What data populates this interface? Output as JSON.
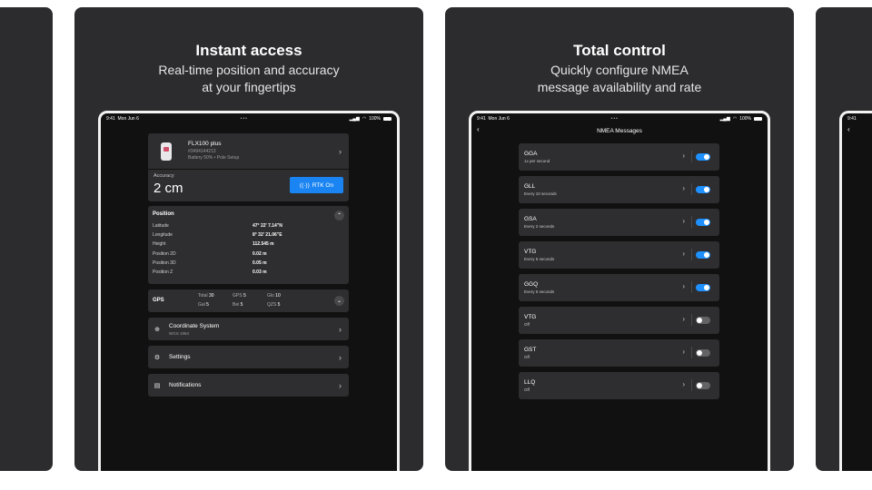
{
  "colors": {
    "accent": "#1a84f2",
    "card_bg": "#2c2c2e",
    "screen_bg": "#111111",
    "toggle_on": "#1e90ff"
  },
  "panel1": {
    "title": "Instant access",
    "subtitle": "Real-time position and accuracy\nat your fingertips",
    "status": {
      "time": "9:41",
      "date": "Mon Jun 6",
      "dots": "•••",
      "battery": "100%"
    },
    "device": {
      "name": "FLX100 plus",
      "serial": "#3494144213",
      "info": "Battery 50% • Pole Setup",
      "icon": "receiver-device"
    },
    "accuracy": {
      "label": "Accuracy",
      "value": "2 cm",
      "rtk_button": "RTK On"
    },
    "position": {
      "title": "Position",
      "rows": [
        {
          "k": "Latitude",
          "v": "47° 22' 7.14\"N"
        },
        {
          "k": "Longitude",
          "v": "8° 32' 21.06\"E"
        },
        {
          "k": "Height",
          "v": "112.545  m"
        },
        {
          "k": "Position 2D",
          "v": "0.02 m"
        },
        {
          "k": "Position 3D",
          "v": "0.05 m"
        },
        {
          "k": "Position Z",
          "v": "0.03 m"
        }
      ]
    },
    "gps": {
      "title": "GPS",
      "cells": [
        {
          "label": "Total",
          "value": "30"
        },
        {
          "label": "GPS",
          "value": "5"
        },
        {
          "label": "Glo",
          "value": "10"
        },
        {
          "label": "Gal",
          "value": "5"
        },
        {
          "label": "Bei",
          "value": "5"
        },
        {
          "label": "QZS",
          "value": "5"
        }
      ]
    },
    "menu": [
      {
        "label": "Coordinate System",
        "sub": "WGS 1984",
        "icon": "globe-icon"
      },
      {
        "label": "Settings",
        "sub": "",
        "icon": "gear-icon"
      },
      {
        "label": "Notifications",
        "sub": "",
        "icon": "clipboard-icon"
      }
    ]
  },
  "panel2": {
    "title": "Total control",
    "subtitle": "Quickly configure NMEA\nmessage availability and rate",
    "status": {
      "time": "9:41",
      "date": "Mon Jun 6",
      "dots": "•••",
      "battery": "100%"
    },
    "nav_title": "NMEA Messages",
    "messages": [
      {
        "name": "GGA",
        "rate": "1x per second",
        "enabled": true
      },
      {
        "name": "GLL",
        "rate": "Every 10 seconds",
        "enabled": true
      },
      {
        "name": "GSA",
        "rate": "Every 2 seconds",
        "enabled": true
      },
      {
        "name": "VTG",
        "rate": "Every 5 seconds",
        "enabled": true
      },
      {
        "name": "GGQ",
        "rate": "Every 5 seconds",
        "enabled": true
      },
      {
        "name": "VTG",
        "rate": "Off",
        "enabled": false
      },
      {
        "name": "GST",
        "rate": "Off",
        "enabled": false
      },
      {
        "name": "LLQ",
        "rate": "Off",
        "enabled": false
      }
    ]
  },
  "panel3": {
    "status": {
      "time": "9:41"
    }
  }
}
